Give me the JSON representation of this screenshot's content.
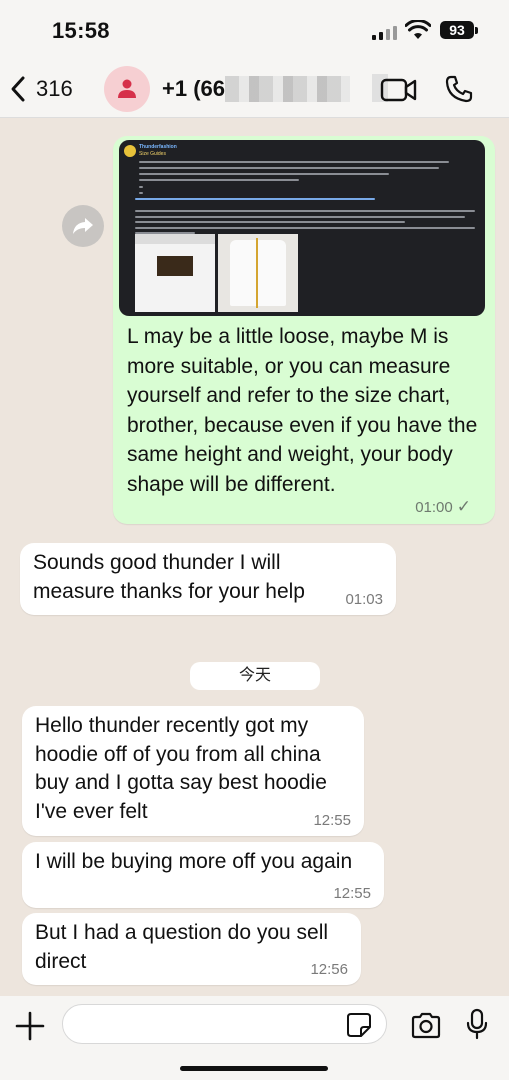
{
  "status": {
    "time": "15:58",
    "battery": "93"
  },
  "header": {
    "back_count": "316",
    "contact_name": "+1 (66"
  },
  "preview": {
    "author": "Thunderfashion",
    "title": "Size Guides"
  },
  "messages_out": [
    {
      "text": "L may be a little loose, maybe M is more suitable, or you can measure yourself and refer to the size chart, brother, because even if you have the same height and weight, your body shape will be different.",
      "time": "01:00",
      "status": "✓"
    }
  ],
  "messages_in": [
    {
      "text": "Sounds good thunder I will measure thanks for your help",
      "time": "01:03"
    },
    {
      "text": "Hello thunder recently got my hoodie off of you from all china buy and I gotta say best hoodie I've ever felt",
      "time": "12:55"
    },
    {
      "text": "I will be buying more off you again",
      "time": "12:55"
    },
    {
      "text": "But I had a question do you sell direct",
      "time": "12:56"
    }
  ],
  "date_divider": "今天",
  "composer": {
    "placeholder": ""
  },
  "icons": {
    "back": "chevron-left-icon",
    "avatar": "person-icon",
    "video": "video-camera-icon",
    "call": "phone-icon",
    "forward": "forward-icon",
    "plus": "plus-icon",
    "sticker": "sticker-icon",
    "camera": "camera-icon",
    "mic": "microphone-icon"
  },
  "colors": {
    "outgoing_bubble": "#d9fdd3",
    "incoming_bubble": "#ffffff",
    "chat_background": "#ede5dd",
    "avatar_bg": "#f6cfd2",
    "avatar_icon": "#d6304a"
  }
}
